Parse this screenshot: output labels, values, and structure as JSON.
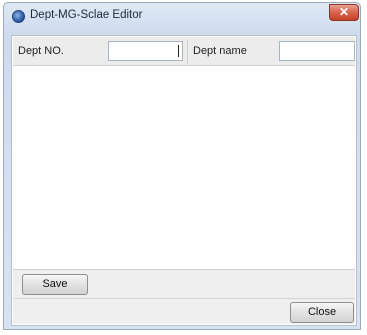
{
  "window": {
    "title": "Dept-MG-Sclae Editor",
    "close_glyph": "✕"
  },
  "form": {
    "dept_no_label": "Dept NO.",
    "dept_no_value": "",
    "dept_name_label": "Dept name",
    "dept_name_value": ""
  },
  "buttons": {
    "save_label": "Save",
    "close_label": "Close"
  }
}
